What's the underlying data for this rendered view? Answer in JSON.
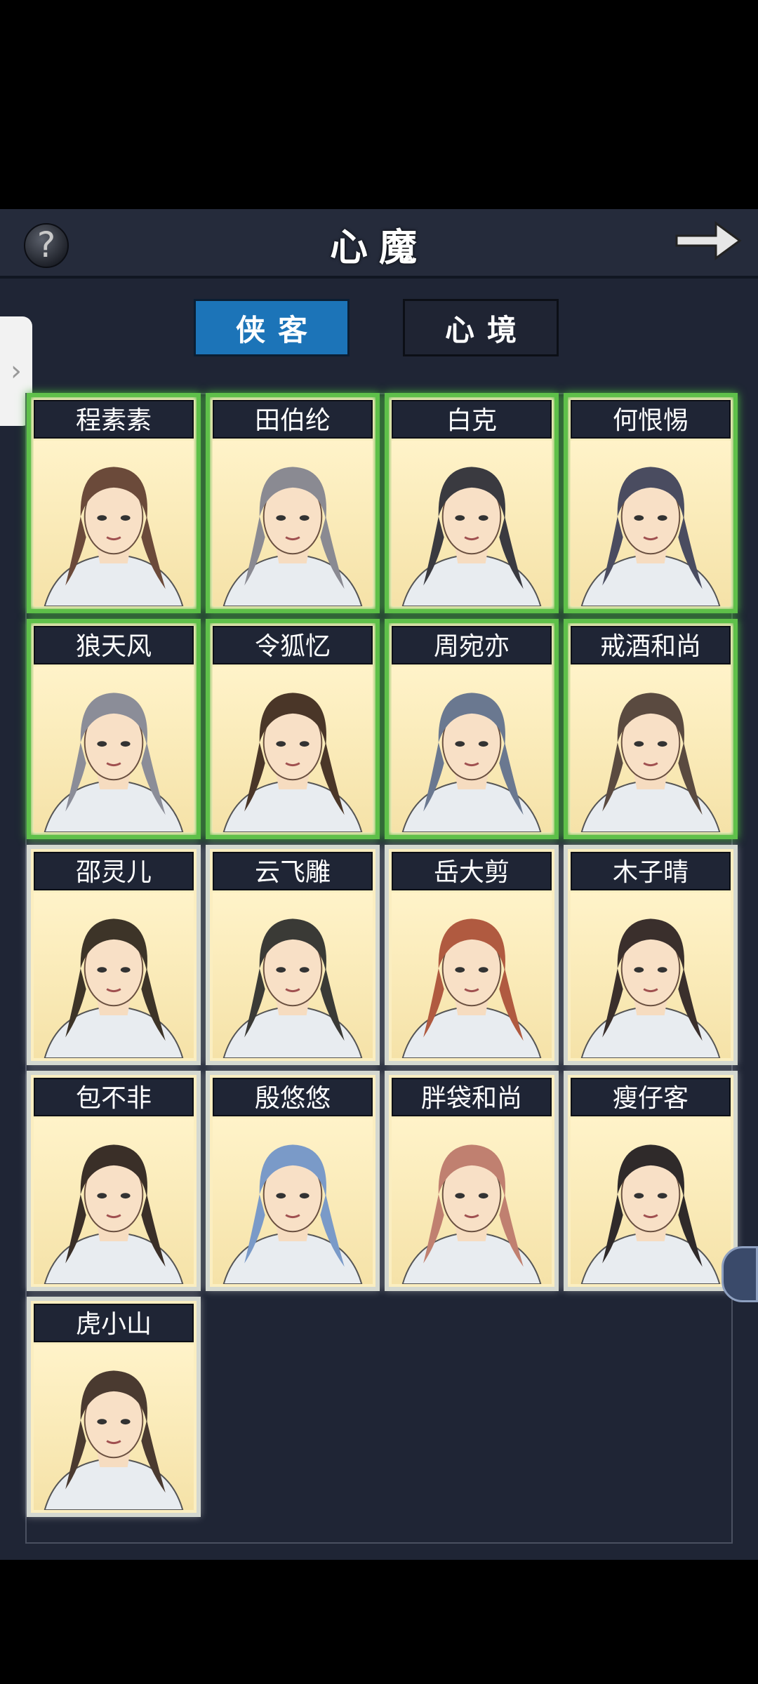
{
  "header": {
    "title": "心魔",
    "help_icon": "question-mark-icon",
    "next_icon": "arrow-right-icon"
  },
  "tabs": [
    {
      "label": "侠客",
      "active": true
    },
    {
      "label": "心境",
      "active": false
    }
  ],
  "characters": [
    {
      "name": "程素素",
      "highlight": true
    },
    {
      "name": "田伯纶",
      "highlight": true
    },
    {
      "name": "白克",
      "highlight": true
    },
    {
      "name": "何恨惕",
      "highlight": true
    },
    {
      "name": "狼天风",
      "highlight": true
    },
    {
      "name": "令狐忆",
      "highlight": true
    },
    {
      "name": "周宛亦",
      "highlight": true
    },
    {
      "name": "戒酒和尚",
      "highlight": true
    },
    {
      "name": "邵灵儿",
      "highlight": false
    },
    {
      "name": "云飞雕",
      "highlight": false
    },
    {
      "name": "岳大剪",
      "highlight": false
    },
    {
      "name": "木子晴",
      "highlight": false
    },
    {
      "name": "包不非",
      "highlight": false
    },
    {
      "name": "殷悠悠",
      "highlight": false
    },
    {
      "name": "胖袋和尚",
      "highlight": false
    },
    {
      "name": "瘦仔客",
      "highlight": false
    },
    {
      "name": "虎小山",
      "highlight": false
    }
  ],
  "colors": {
    "active_tab": "#1c74b8",
    "highlight_border": "#5fc04a",
    "panel_bg": "#1f2535"
  }
}
